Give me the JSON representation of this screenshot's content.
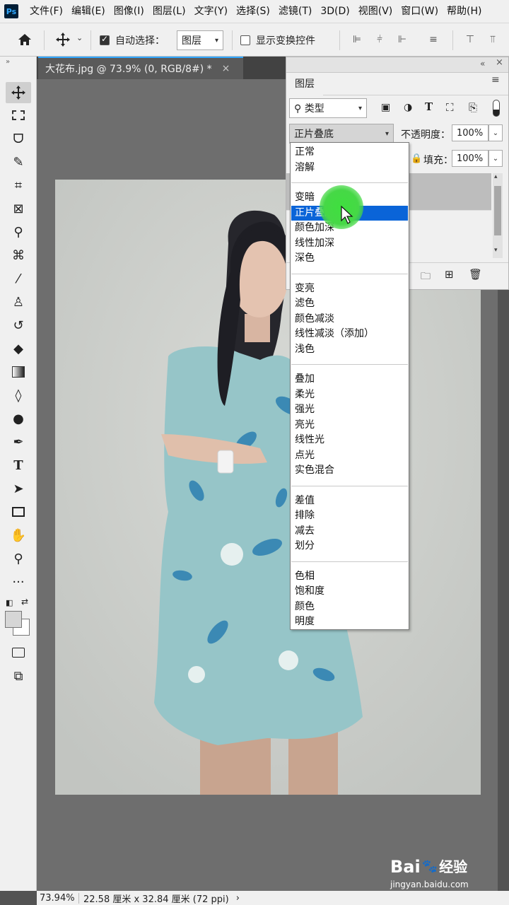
{
  "menubar": {
    "logo": "Ps",
    "items": [
      "文件(F)",
      "编辑(E)",
      "图像(I)",
      "图层(L)",
      "文字(Y)",
      "选择(S)",
      "滤镜(T)",
      "3D(D)",
      "视图(V)",
      "窗口(W)",
      "帮助(H)"
    ]
  },
  "options": {
    "auto_select_label": "自动选择：",
    "auto_select_checked": true,
    "auto_select_target": "图层",
    "show_transform_label": "显示变换控件",
    "show_transform_checked": false
  },
  "document": {
    "tab_title": "大花布.jpg @ 73.9% (0, RGB/8#) *",
    "close_glyph": "×"
  },
  "status": {
    "zoom": "73.94%",
    "doc_size": "22.58 厘米 x 32.84 厘米 (72 ppi)",
    "arrow": "›"
  },
  "layers_panel": {
    "tab": "图层",
    "filter_label": "类型",
    "blend_mode": "正片叠底",
    "opacity_label": "不透明度：",
    "opacity_value": "100%",
    "fill_label": "填充：",
    "fill_value": "100%"
  },
  "blend_menu": {
    "groups": [
      [
        "正常",
        "溶解"
      ],
      [
        "变暗",
        "正片叠底",
        "颜色加深",
        "线性加深",
        "深色"
      ],
      [
        "变亮",
        "滤色",
        "颜色减淡",
        "线性减淡（添加）",
        "浅色"
      ],
      [
        "叠加",
        "柔光",
        "强光",
        "亮光",
        "线性光",
        "点光",
        "实色混合"
      ],
      [
        "差值",
        "排除",
        "减去",
        "划分"
      ],
      [
        "色相",
        "饱和度",
        "颜色",
        "明度"
      ]
    ],
    "selected": "正片叠底"
  },
  "watermark": {
    "brand": "Bai",
    "brand2": "经验",
    "url": "jingyan.baidu.com"
  },
  "colors": {
    "ui_bg": "#f0f0f0",
    "dark_bg": "#535353",
    "canvas_bg": "#6e6e6e",
    "selection": "#0a64d8",
    "accent": "#31a8ff",
    "cursor_highlight": "#46d846"
  }
}
